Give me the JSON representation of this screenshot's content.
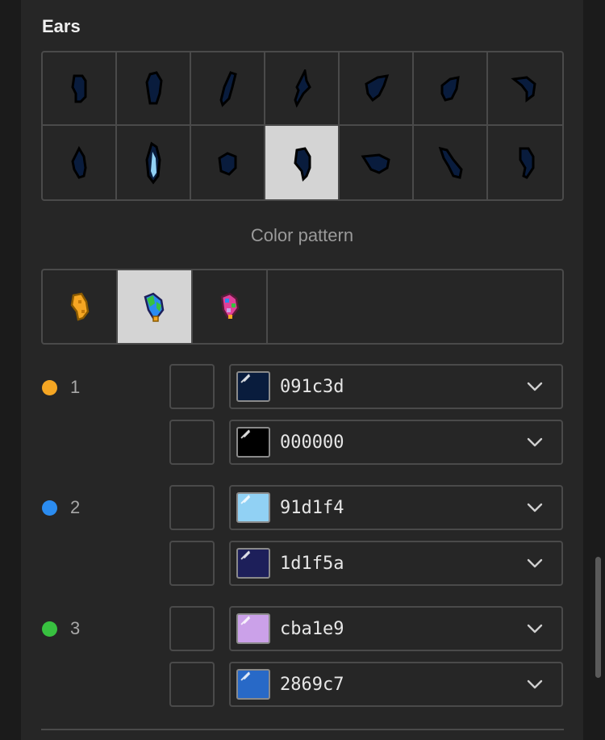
{
  "section": {
    "title": "Ears"
  },
  "subheading": "Color pattern",
  "ears": {
    "selected_index": 10,
    "count": 14
  },
  "patterns": {
    "selected_index": 1,
    "count": 3
  },
  "color_groups": [
    {
      "number": "1",
      "dot_color": "#f5a623",
      "entries": [
        {
          "hex": "091c3d",
          "swatch": "#091c3d"
        },
        {
          "hex": "000000",
          "swatch": "#000000"
        }
      ]
    },
    {
      "number": "2",
      "dot_color": "#2b8cf0",
      "entries": [
        {
          "hex": "91d1f4",
          "swatch": "#91d1f4"
        },
        {
          "hex": "1d1f5a",
          "swatch": "#1d1f5a"
        }
      ]
    },
    {
      "number": "3",
      "dot_color": "#38c140",
      "entries": [
        {
          "hex": "cba1e9",
          "swatch": "#cba1e9"
        },
        {
          "hex": "2869c7",
          "swatch": "#2869c7"
        }
      ]
    }
  ],
  "icons": {
    "dropdown": "chevron-down-icon"
  }
}
